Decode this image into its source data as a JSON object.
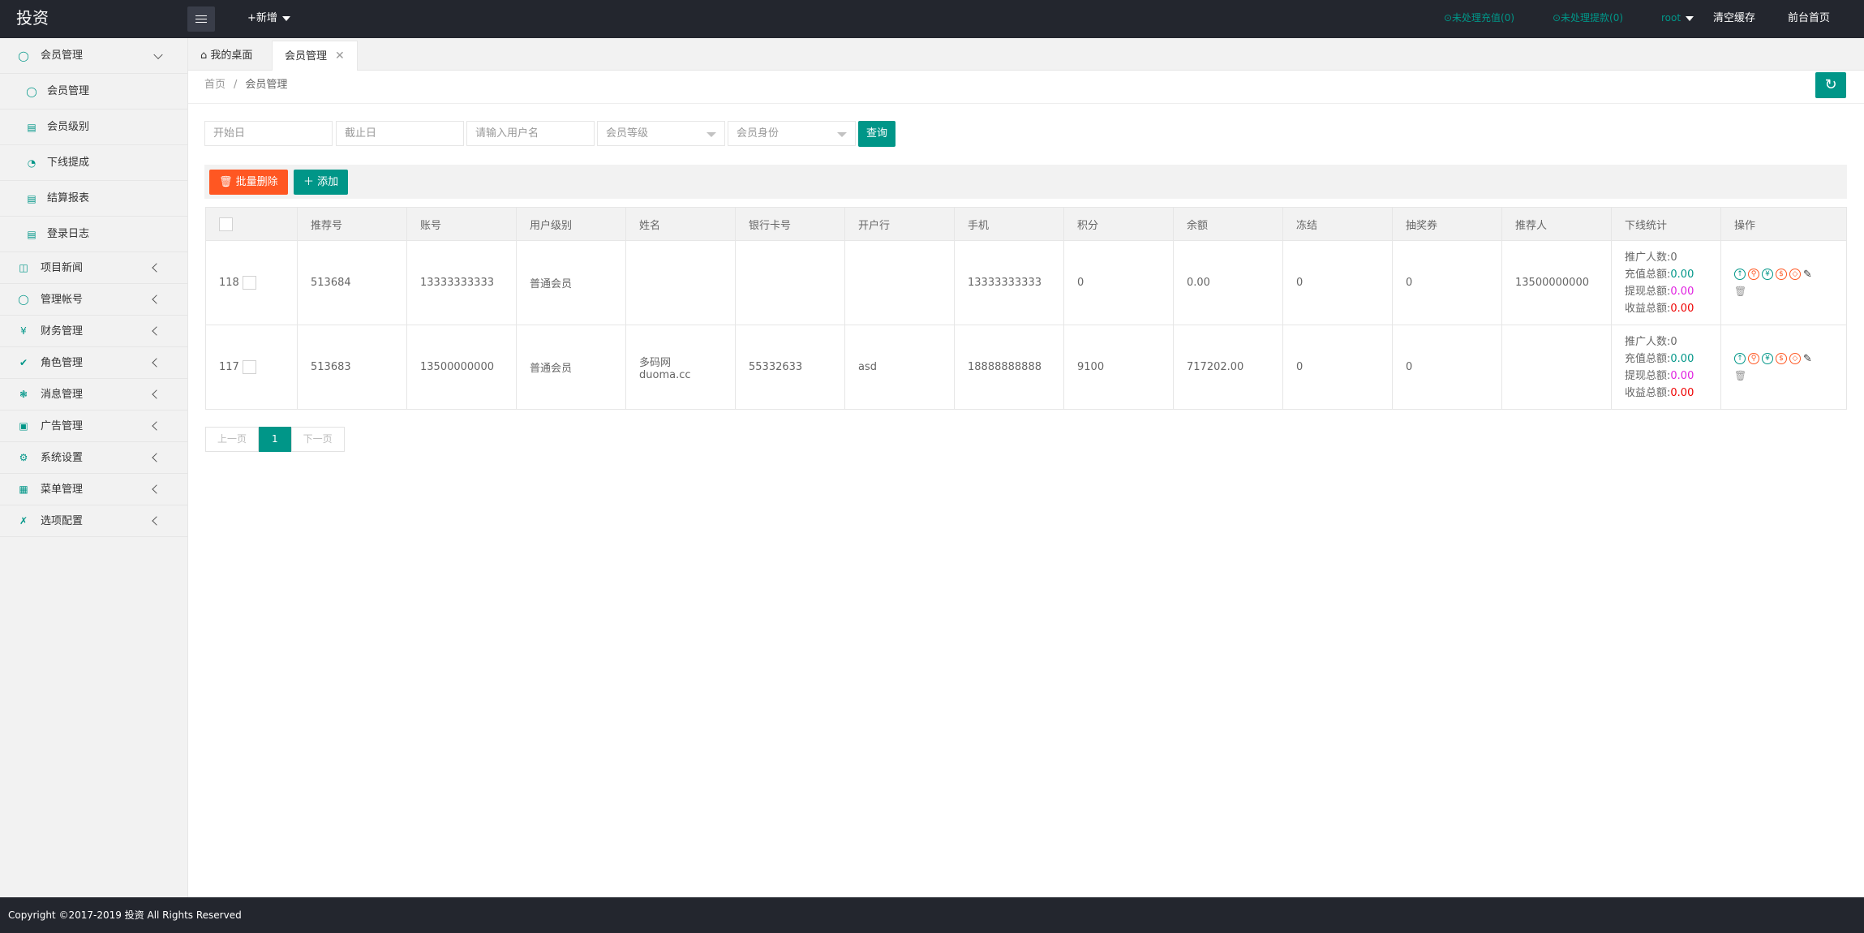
{
  "header": {
    "logo": "投资",
    "new_menu": "+新增",
    "recharge_pending": "⊙未处理充值(0)",
    "withdraw_pending": "⊙未处理提款(0)",
    "user": "root",
    "clear_cache": "清空缓存",
    "front_home": "前台首页"
  },
  "sidebar": {
    "member_mgmt": "会员管理",
    "subs": [
      "会员管理",
      "会员级别",
      "下线提成",
      "结算报表",
      "登录日志"
    ],
    "items": [
      "项目新闻",
      "管理帐号",
      "财务管理",
      "角色管理",
      "消息管理",
      "广告管理",
      "系统设置",
      "菜单管理",
      "选项配置"
    ]
  },
  "tabs": {
    "desktop": "我的桌面",
    "members": "会员管理",
    "close": "✕"
  },
  "breadcrumb": {
    "home": "首页",
    "sep": "/",
    "current": "会员管理"
  },
  "search": {
    "start_date": "开始日",
    "end_date": "截止日",
    "username": "请输入用户名",
    "level": "会员等级",
    "identity": "会员身份",
    "query": "查询"
  },
  "toolbar": {
    "batch_delete": "批量删除",
    "add": "添加"
  },
  "table": {
    "headers": [
      "推荐号",
      "账号",
      "用户级别",
      "姓名",
      "银行卡号",
      "开户行",
      "手机",
      "积分",
      "余额",
      "冻结",
      "抽奖券",
      "推荐人",
      "下线统计",
      "操作"
    ],
    "stat_labels": {
      "promoted": "推广人数:",
      "recharge": "充值总额:",
      "withdraw": "提现总额:",
      "income": "收益总额:"
    },
    "rows": [
      {
        "id": "118",
        "ref_no": "513684",
        "account": "13333333333",
        "level": "普通会员",
        "name": "",
        "bank_card": "",
        "bank": "",
        "phone": "13333333333",
        "points": "0",
        "balance": "0.00",
        "frozen": "0",
        "tickets": "0",
        "referrer": "13500000000",
        "promoted": "0",
        "recharge": "0.00",
        "withdraw": "0.00",
        "income": "0.00"
      },
      {
        "id": "117",
        "ref_no": "513683",
        "account": "13500000000",
        "level": "普通会员",
        "name": "多码网duoma.cc",
        "bank_card": "55332633",
        "bank": "asd",
        "phone": "18888888888",
        "points": "9100",
        "balance": "717202.00",
        "frozen": "0",
        "tickets": "0",
        "referrer": "",
        "promoted": "0",
        "recharge": "0.00",
        "withdraw": "0.00",
        "income": "0.00"
      }
    ]
  },
  "pager": {
    "prev": "上一页",
    "current": "1",
    "next": "下一页"
  },
  "footer": {
    "copyright": "Copyright ©2017-2019 投资 All Rights Reserved"
  },
  "colors": {
    "accent": "#009688",
    "danger": "#ff5722",
    "dark": "#23262e"
  }
}
